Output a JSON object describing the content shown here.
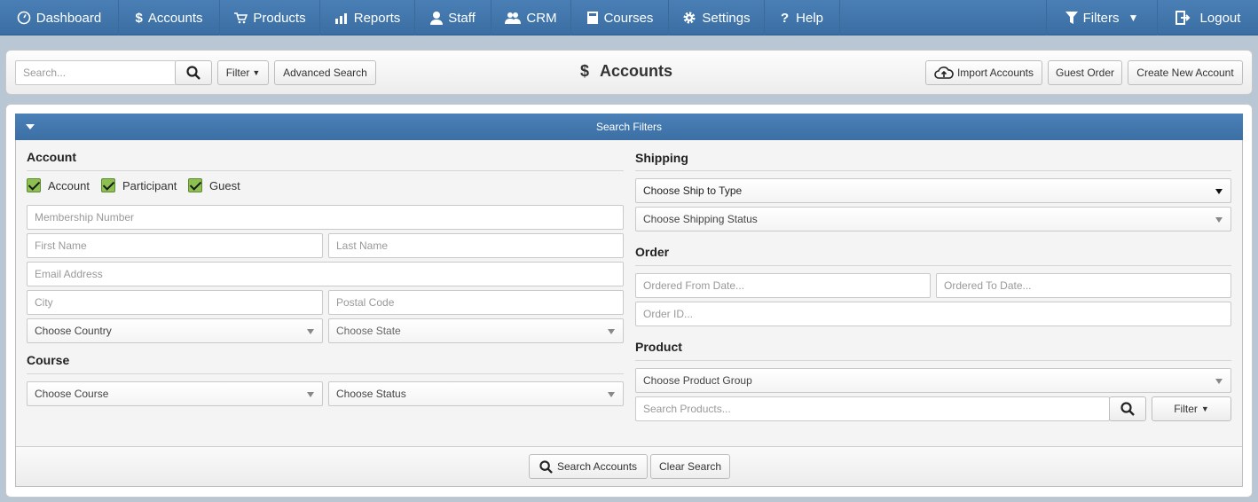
{
  "nav": {
    "items": [
      {
        "label": "Dashboard",
        "icon": "dashboard-icon"
      },
      {
        "label": "Accounts",
        "icon": "dollar-icon"
      },
      {
        "label": "Products",
        "icon": "cart-icon"
      },
      {
        "label": "Reports",
        "icon": "chart-icon"
      },
      {
        "label": "Staff",
        "icon": "user-icon"
      },
      {
        "label": "CRM",
        "icon": "users-icon"
      },
      {
        "label": "Courses",
        "icon": "book-icon"
      },
      {
        "label": "Settings",
        "icon": "gear-icon"
      },
      {
        "label": "Help",
        "icon": "question-icon"
      }
    ],
    "filters_label": "Filters",
    "logout_label": "Logout"
  },
  "toolbar": {
    "search_placeholder": "Search...",
    "filter_label": "Filter",
    "advanced_search_label": "Advanced Search",
    "page_title": "Accounts",
    "import_label": "Import Accounts",
    "guest_order_label": "Guest Order",
    "create_label": "Create New Account"
  },
  "filters": {
    "header": "Search Filters",
    "account": {
      "title": "Account",
      "checkboxes": [
        {
          "label": "Account",
          "checked": true
        },
        {
          "label": "Participant",
          "checked": true
        },
        {
          "label": "Guest",
          "checked": true
        }
      ],
      "membership_placeholder": "Membership Number",
      "first_name_placeholder": "First Name",
      "last_name_placeholder": "Last Name",
      "email_placeholder": "Email Address",
      "city_placeholder": "City",
      "postal_placeholder": "Postal Code",
      "country_select": "Choose Country",
      "state_select": "Choose State"
    },
    "course": {
      "title": "Course",
      "course_select": "Choose Course",
      "status_select": "Choose Status"
    },
    "shipping": {
      "title": "Shipping",
      "ship_type_select": "Choose Ship to Type",
      "ship_status_select": "Choose Shipping Status"
    },
    "order": {
      "title": "Order",
      "from_placeholder": "Ordered From Date...",
      "to_placeholder": "Ordered To Date...",
      "id_placeholder": "Order ID..."
    },
    "product": {
      "title": "Product",
      "group_select": "Choose Product Group",
      "search_placeholder": "Search Products...",
      "filter_label": "Filter"
    }
  },
  "footer": {
    "search_label": "Search Accounts",
    "clear_label": "Clear Search"
  },
  "colors": {
    "nav": "#3f74aa",
    "checkbox": "#8cc152"
  }
}
